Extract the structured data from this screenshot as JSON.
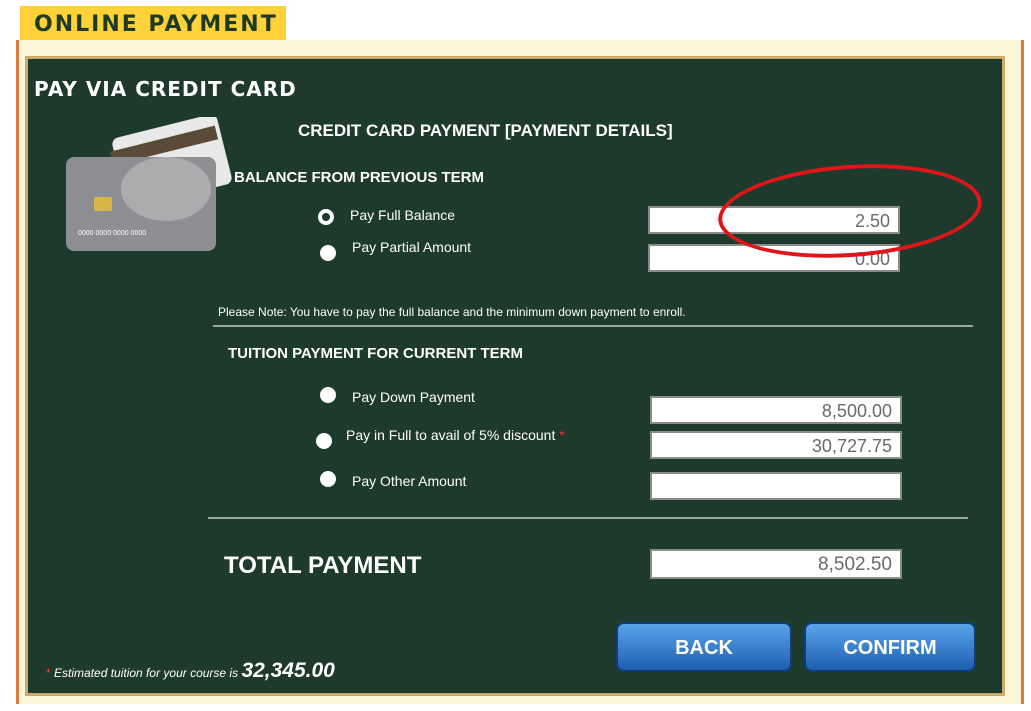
{
  "header": {
    "title": "ONLINE PAYMENT"
  },
  "panel": {
    "title": "PAY VIA CREDIT CARD",
    "main_title": "CREDIT CARD PAYMENT [PAYMENT DETAILS]",
    "card_icon": "credit-card-icon",
    "card_number_text": "0000 0000 0000 0000"
  },
  "balance": {
    "section_title": "BALANCE FROM PREVIOUS TERM",
    "options": [
      {
        "label": "Pay Full Balance",
        "selected": true,
        "amount": "2.50"
      },
      {
        "label": "Pay Partial Amount",
        "selected": false,
        "amount": "0.00"
      }
    ],
    "note": "Please Note: You have to pay the full balance and the minimum down payment to enroll."
  },
  "tuition": {
    "section_title": "TUITION PAYMENT FOR CURRENT TERM",
    "options": [
      {
        "label": "Pay Down Payment",
        "amount": "8,500.00"
      },
      {
        "label": "Pay in Full to avail of 5% discount",
        "star": "*",
        "amount": "30,727.75"
      },
      {
        "label": "Pay Other Amount",
        "amount": ""
      }
    ]
  },
  "total": {
    "label": "TOTAL PAYMENT",
    "amount": "8,502.50"
  },
  "buttons": {
    "back": "BACK",
    "confirm": "CONFIRM"
  },
  "footer": {
    "star": "*",
    "text": "Estimated tuition for your course is",
    "amount": "32,345.00"
  },
  "colors": {
    "panel": "#1e3a2c",
    "tab": "#ffd23a",
    "button": "#2f7cd0",
    "highlight": "#e0151a"
  }
}
